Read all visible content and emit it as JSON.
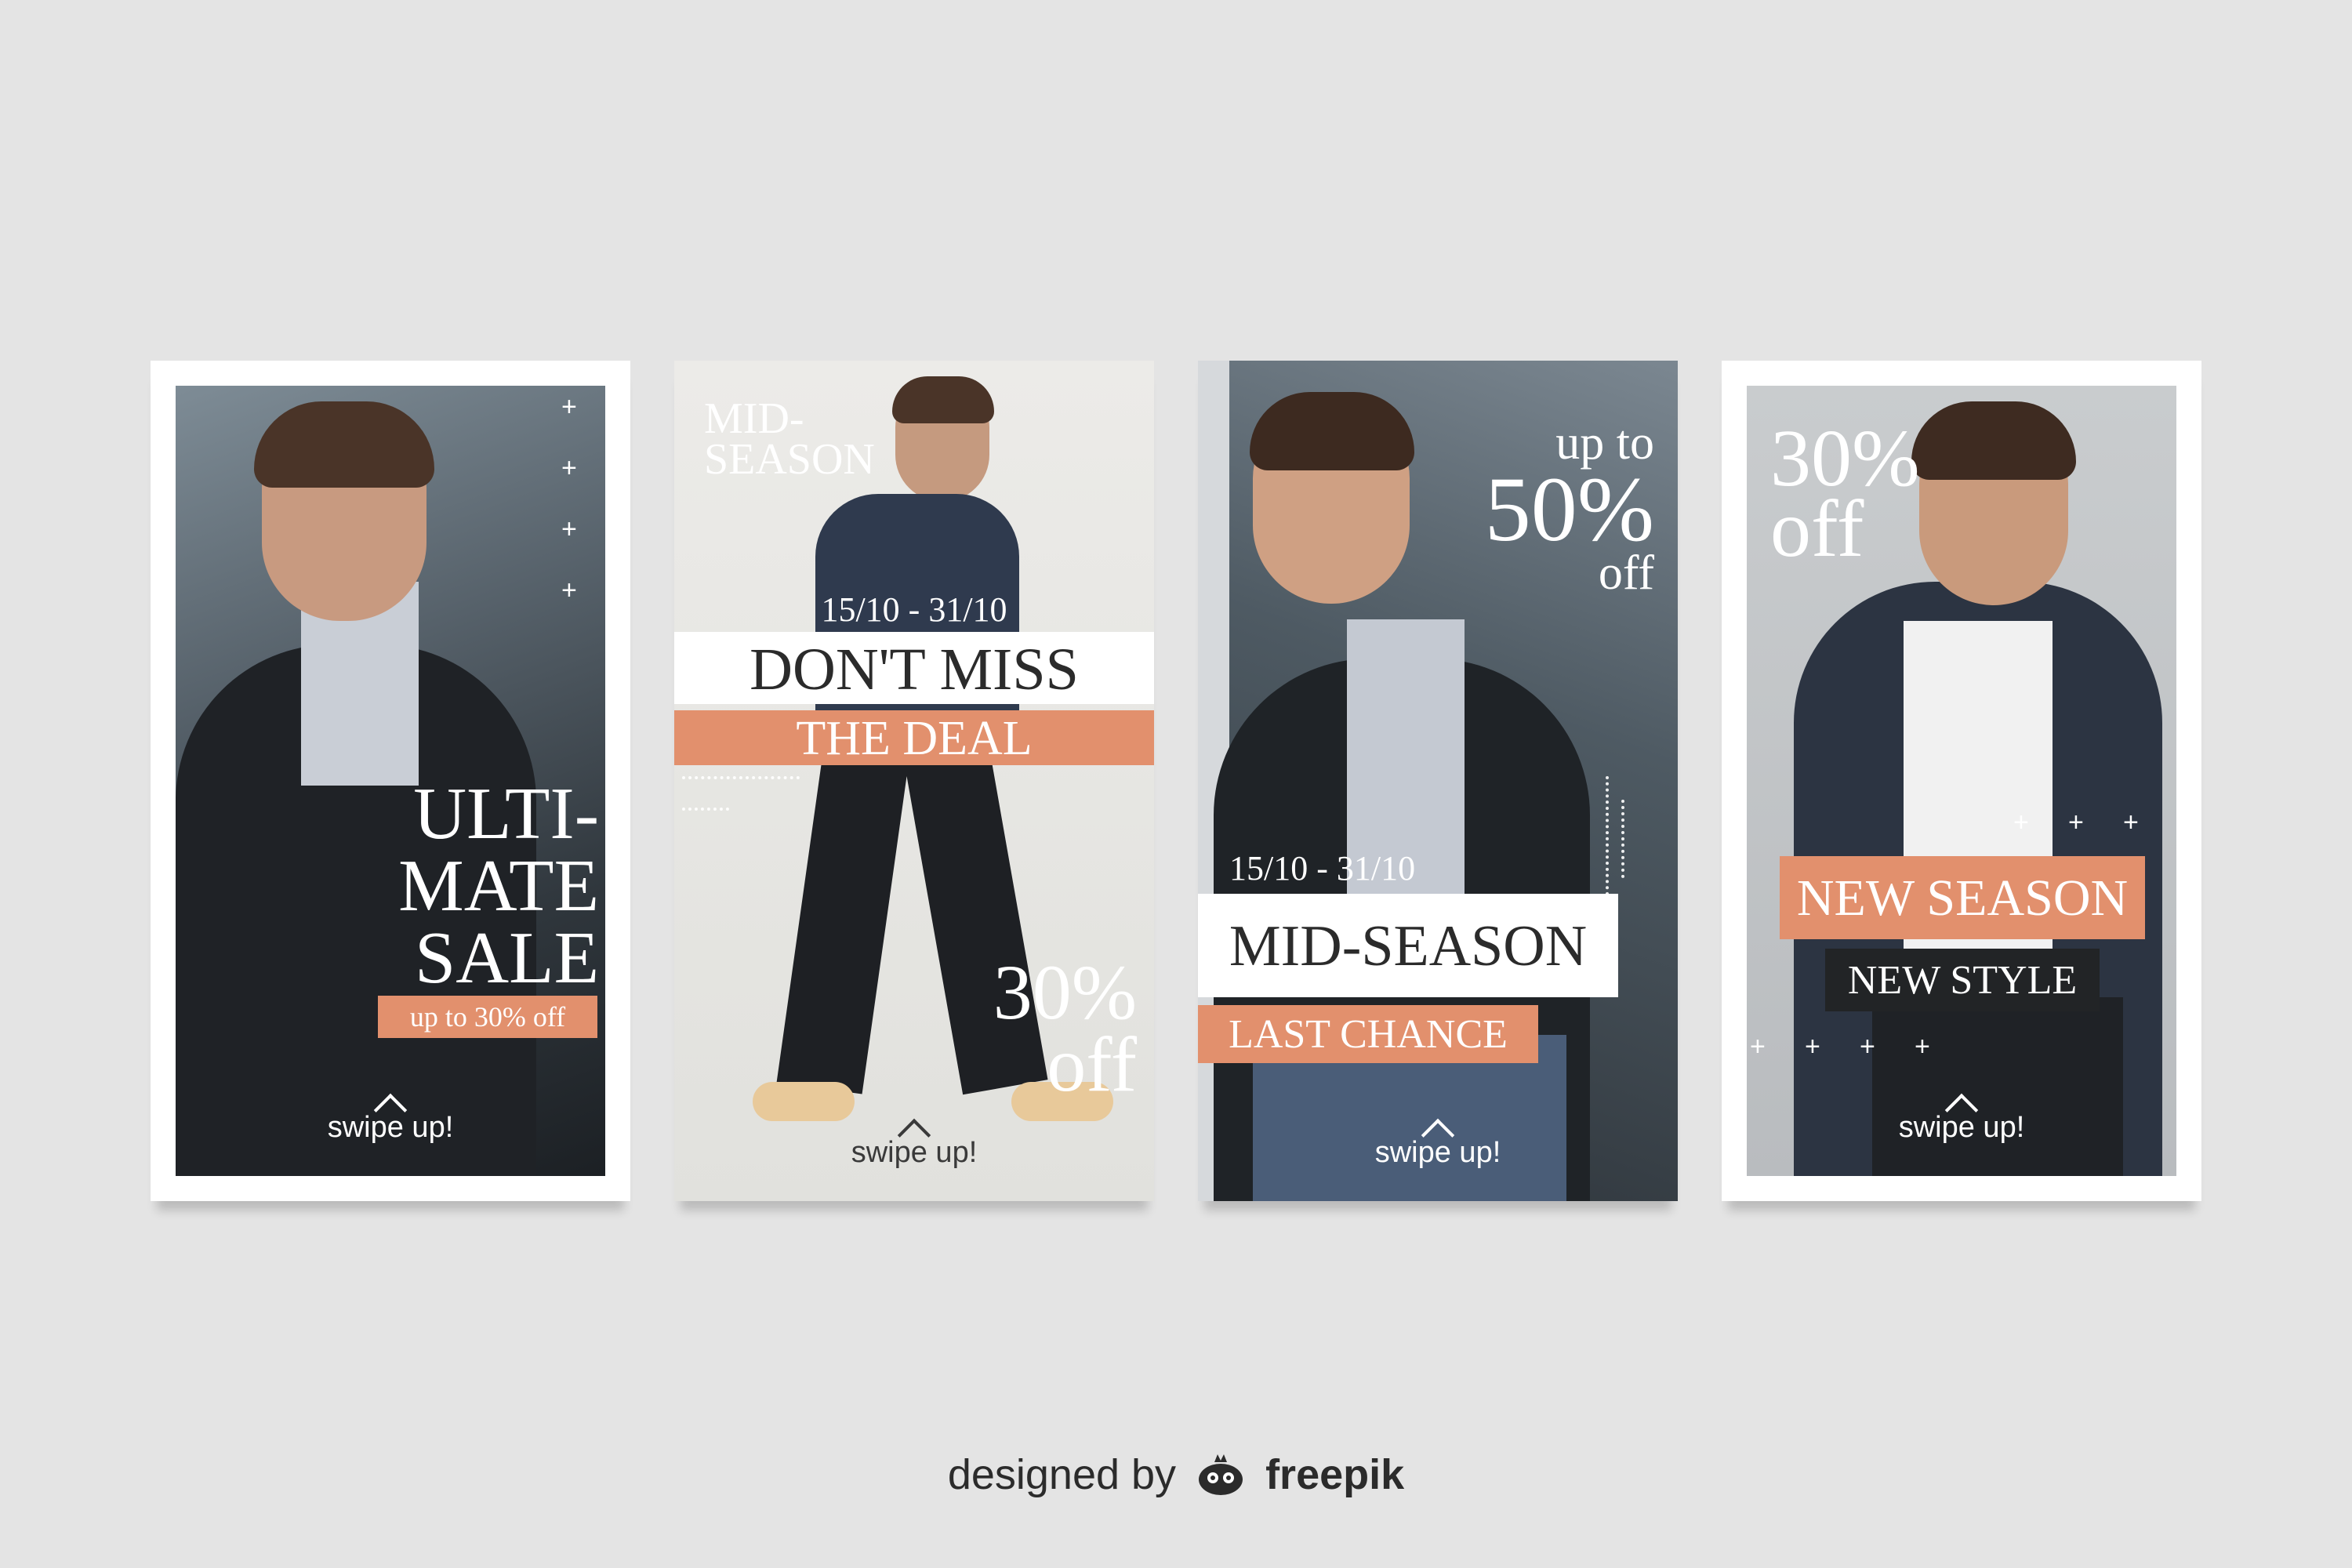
{
  "cards": [
    {
      "headline_1": "ULTI-",
      "headline_2": "MATE",
      "headline_3": "SALE",
      "tag": "up to 30% off",
      "swipe": "swipe up!",
      "plus_glyph": "+"
    },
    {
      "season_1": "MID-",
      "season_2": "SEASON",
      "dates": "15/10 - 31/10",
      "banner_1": "DON'T MISS",
      "banner_2": "THE DEAL",
      "discount_value": "30%",
      "discount_suffix": "off",
      "swipe": "swipe up!"
    },
    {
      "promo_1": "up to",
      "promo_2": "50%",
      "promo_3": "off",
      "dates": "15/10 - 31/10",
      "banner_1": "MID-SEASON",
      "banner_2": "LAST CHANCE",
      "swipe": "swipe up!"
    },
    {
      "discount_value": "30%",
      "discount_suffix": "off",
      "banner_1": "NEW SEASON",
      "banner_2": "NEW STYLE",
      "swipe": "swipe up!",
      "plus_glyph": "+"
    }
  ],
  "footer": {
    "prefix": "designed by",
    "brand": "freepik",
    "logo_icon": "freepik-logo-icon"
  },
  "colors": {
    "background": "#e4e4e4",
    "accent": "#e2906d",
    "dark": "#2b2b2b",
    "white": "#ffffff"
  }
}
